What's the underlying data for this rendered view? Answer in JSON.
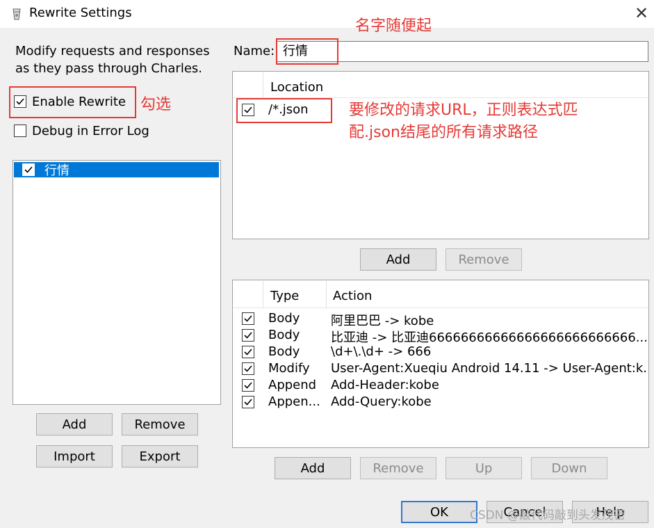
{
  "window": {
    "title": "Rewrite Settings",
    "close_glyph": "✕"
  },
  "left": {
    "description": "Modify requests and responses as they pass through Charles.",
    "enable_rewrite": {
      "label": "Enable Rewrite",
      "checked": true
    },
    "debug_error_log": {
      "label": "Debug in Error Log",
      "checked": false
    },
    "sets": [
      {
        "label": "行情",
        "checked": true,
        "selected": true
      }
    ],
    "buttons": {
      "add": "Add",
      "remove": "Remove",
      "import": "Import",
      "export": "Export"
    }
  },
  "name_field": {
    "label": "Name:",
    "value": "行情"
  },
  "locations": {
    "header": "Location",
    "rows": [
      {
        "checked": true,
        "value": "/*.json"
      }
    ],
    "buttons": {
      "add": "Add",
      "remove": "Remove"
    }
  },
  "rules": {
    "headers": {
      "type": "Type",
      "action": "Action"
    },
    "rows": [
      {
        "checked": true,
        "type": "Body",
        "action": "阿里巴巴 -> kobe"
      },
      {
        "checked": true,
        "type": "Body",
        "action": "比亚迪 -> 比亚迪66666666666666666666666666..."
      },
      {
        "checked": true,
        "type": "Body",
        "action": "\\d+\\.\\d+ -> 666"
      },
      {
        "checked": true,
        "type": "Modify",
        "action": "User-Agent:Xueqiu Android 14.11 -> User-Agent:k..."
      },
      {
        "checked": true,
        "type": "Append",
        "action": "Add-Header:kobe"
      },
      {
        "checked": true,
        "type": "Appen...",
        "action": "Add-Query:kobe"
      }
    ],
    "buttons": {
      "add": "Add",
      "remove": "Remove",
      "up": "Up",
      "down": "Down"
    }
  },
  "footer": {
    "ok": "OK",
    "cancel": "Cancel",
    "help": "Help"
  },
  "annotations": {
    "name_note": "名字随便起",
    "check_note": "勾选",
    "location_note_line1": "要修改的请求URL，正则表达式匹",
    "location_note_line2": "配.json结尾的所有请求路径"
  },
  "watermark": "CSDN @敲代码敲到头发茂密",
  "colors": {
    "annotation": "#e53935",
    "selection": "#0078d7",
    "primary_border": "#2e77d0"
  }
}
